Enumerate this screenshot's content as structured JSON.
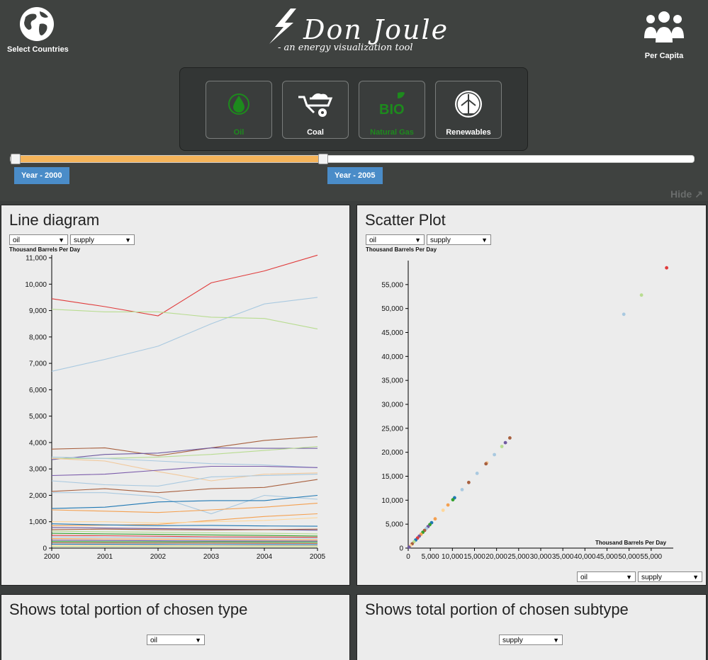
{
  "header": {
    "select_countries_label": "Select Countries",
    "logo_title": "Don Joule",
    "logo_subtitle": "- an energy visualization tool",
    "per_capita_label": "Per Capita",
    "hide_label": "Hide",
    "types": [
      {
        "label": "Oil",
        "icon": "oil-drop-icon",
        "color": "#1d8a1d"
      },
      {
        "label": "Coal",
        "icon": "wheelbarrow-icon",
        "color": "#ffffff"
      },
      {
        "label": "Natural Gas",
        "icon": "bio-icon",
        "color": "#1d8a1d"
      },
      {
        "label": "Renewables",
        "icon": "wind-turbine-icon",
        "color": "#ffffff"
      }
    ],
    "slider": {
      "min_year": 2000,
      "max_year": 2005,
      "start_label": "Year - 2000",
      "end_label": "Year - 2005",
      "fill_color": "#f5b45a"
    }
  },
  "line_panel": {
    "title": "Line diagram",
    "type_select": "oil",
    "subtype_select": "supply",
    "unit_label": "Thousand Barrels Per Day"
  },
  "scatter_panel": {
    "title": "Scatter Plot",
    "type_select": "oil",
    "subtype_select": "supply",
    "unit_label": "Thousand Barrels Per Day",
    "x_unit_label": "Thousand Barrels Per Day",
    "bottom_type_select": "oil",
    "bottom_subtype_select": "supply"
  },
  "type_portion_panel": {
    "title": "Shows total portion of chosen type",
    "select": "oil"
  },
  "subtype_portion_panel": {
    "title": "Shows total portion of chosen subtype",
    "select": "supply"
  },
  "chart_data": [
    {
      "type": "line",
      "x": [
        2000,
        2001,
        2002,
        2003,
        2004,
        2005
      ],
      "ylabel": "Thousand Barrels Per Day",
      "ylim": [
        0,
        11000
      ],
      "yticks": [
        "0",
        "1,000",
        "2,000",
        "3,000",
        "4,000",
        "5,000",
        "6,000",
        "7,000",
        "8,000",
        "9,000",
        "10,000",
        "11,000"
      ],
      "xticks": [
        "2000",
        "2001",
        "2002",
        "2003",
        "2004",
        "2005"
      ],
      "series": [
        {
          "color": "#e03b3b",
          "values": [
            9450,
            9150,
            8800,
            10050,
            10500,
            11100
          ]
        },
        {
          "color": "#a9c9e0",
          "values": [
            6700,
            7150,
            7650,
            8500,
            9250,
            9500
          ]
        },
        {
          "color": "#b8dc90",
          "values": [
            9050,
            8950,
            8950,
            8750,
            8700,
            8300
          ]
        },
        {
          "color": "#a8603f",
          "values": [
            3750,
            3800,
            3500,
            3800,
            4080,
            4220
          ]
        },
        {
          "color": "#6f5aa0",
          "values": [
            3350,
            3550,
            3600,
            3800,
            3780,
            3780
          ]
        },
        {
          "color": "#b8dc90",
          "values": [
            3400,
            3400,
            3450,
            3550,
            3700,
            3850
          ]
        },
        {
          "color": "#a9c9e0",
          "values": [
            3450,
            3400,
            3300,
            3200,
            3150,
            3050
          ]
        },
        {
          "color": "#f2c89a",
          "values": [
            3400,
            3300,
            2900,
            2550,
            2800,
            2850
          ]
        },
        {
          "color": "#7a5aaa",
          "values": [
            2750,
            2800,
            2950,
            3100,
            3100,
            3050
          ]
        },
        {
          "color": "#a9c9e0",
          "values": [
            2550,
            2400,
            2350,
            2700,
            2750,
            2800
          ]
        },
        {
          "color": "#a8603f",
          "values": [
            2150,
            2250,
            2100,
            2250,
            2300,
            2600
          ]
        },
        {
          "color": "#a9c9e0",
          "values": [
            2100,
            2100,
            1950,
            1300,
            2000,
            1850
          ]
        },
        {
          "color": "#1f78b4",
          "values": [
            1500,
            1550,
            1750,
            1800,
            1800,
            2000
          ]
        },
        {
          "color": "#f4a050",
          "values": [
            1450,
            1400,
            1350,
            1450,
            1550,
            1700
          ]
        },
        {
          "color": "#f4a050",
          "values": [
            850,
            870,
            900,
            1050,
            1200,
            1300
          ]
        },
        {
          "color": "#ffd79a",
          "values": [
            1000,
            1000,
            950,
            1000,
            1050,
            1150
          ]
        },
        {
          "color": "#1f78b4",
          "values": [
            920,
            880,
            850,
            860,
            840,
            830
          ]
        },
        {
          "color": "#6f5aa0",
          "values": [
            780,
            760,
            740,
            720,
            700,
            680
          ]
        },
        {
          "color": "#a8603f",
          "values": [
            700,
            720,
            700,
            690,
            700,
            720
          ]
        },
        {
          "color": "#b8dc90",
          "values": [
            640,
            620,
            600,
            580,
            560,
            540
          ]
        },
        {
          "color": "#33a02c",
          "values": [
            560,
            540,
            520,
            500,
            480,
            460
          ]
        },
        {
          "color": "#e03b3b",
          "values": [
            480,
            470,
            450,
            430,
            420,
            410
          ]
        },
        {
          "color": "#a9c9e0",
          "values": [
            420,
            410,
            400,
            390,
            380,
            370
          ]
        },
        {
          "color": "#f4a050",
          "values": [
            360,
            350,
            340,
            330,
            320,
            310
          ]
        },
        {
          "color": "#6f5aa0",
          "values": [
            300,
            290,
            280,
            275,
            270,
            265
          ]
        },
        {
          "color": "#33a02c",
          "values": [
            250,
            245,
            240,
            235,
            230,
            225
          ]
        },
        {
          "color": "#a8603f",
          "values": [
            200,
            195,
            190,
            185,
            180,
            175
          ]
        },
        {
          "color": "#1f78b4",
          "values": [
            150,
            145,
            140,
            135,
            130,
            125
          ]
        },
        {
          "color": "#ffd79a",
          "values": [
            100,
            98,
            96,
            94,
            92,
            90
          ]
        },
        {
          "color": "#b8dc90",
          "values": [
            60,
            58,
            56,
            54,
            52,
            50
          ]
        }
      ]
    },
    {
      "type": "scatter",
      "xlabel": "Thousand Barrels Per Day",
      "ylabel": "Thousand Barrels Per Day",
      "xlim": [
        0,
        60000
      ],
      "ylim": [
        0,
        60000
      ],
      "xticks": [
        "0",
        "5,000",
        "10,000",
        "15,000",
        "20,000",
        "25,000",
        "30,000",
        "35,000",
        "40,000",
        "45,000",
        "50,000",
        "55,000"
      ],
      "yticks": [
        "0",
        "5,000",
        "10,000",
        "15,000",
        "20,000",
        "25,000",
        "30,000",
        "35,000",
        "40,000",
        "45,000",
        "50,000",
        "55,000"
      ],
      "points": [
        {
          "x": 58500,
          "y": 58500,
          "color": "#e03b3b"
        },
        {
          "x": 52800,
          "y": 52800,
          "color": "#b8dc90"
        },
        {
          "x": 48800,
          "y": 48800,
          "color": "#a9c9e0"
        },
        {
          "x": 23000,
          "y": 23000,
          "color": "#a8603f"
        },
        {
          "x": 22000,
          "y": 22000,
          "color": "#6f5aa0"
        },
        {
          "x": 21200,
          "y": 21200,
          "color": "#b8dc90"
        },
        {
          "x": 19500,
          "y": 19500,
          "color": "#a9c9e0"
        },
        {
          "x": 17800,
          "y": 17800,
          "color": "#f2c89a"
        },
        {
          "x": 17600,
          "y": 17600,
          "color": "#a8603f"
        },
        {
          "x": 15600,
          "y": 15600,
          "color": "#a9c9e0"
        },
        {
          "x": 13700,
          "y": 13700,
          "color": "#a8603f"
        },
        {
          "x": 12200,
          "y": 12200,
          "color": "#a9c9e0"
        },
        {
          "x": 10500,
          "y": 10500,
          "color": "#1f78b4"
        },
        {
          "x": 10100,
          "y": 10100,
          "color": "#33a02c"
        },
        {
          "x": 9000,
          "y": 9000,
          "color": "#f4a050"
        },
        {
          "x": 7900,
          "y": 7900,
          "color": "#ffd79a"
        },
        {
          "x": 6100,
          "y": 6100,
          "color": "#f4a050"
        },
        {
          "x": 5300,
          "y": 5300,
          "color": "#1f78b4"
        },
        {
          "x": 4900,
          "y": 4900,
          "color": "#33a02c"
        },
        {
          "x": 4500,
          "y": 4500,
          "color": "#6f5aa0"
        },
        {
          "x": 4100,
          "y": 4100,
          "color": "#a9c9e0"
        },
        {
          "x": 3700,
          "y": 3700,
          "color": "#a8603f"
        },
        {
          "x": 3300,
          "y": 3300,
          "color": "#33a02c"
        },
        {
          "x": 2900,
          "y": 2900,
          "color": "#f4a050"
        },
        {
          "x": 2500,
          "y": 2500,
          "color": "#6f5aa0"
        },
        {
          "x": 2100,
          "y": 2100,
          "color": "#e03b3b"
        },
        {
          "x": 1700,
          "y": 1700,
          "color": "#1f78b4"
        },
        {
          "x": 1300,
          "y": 1300,
          "color": "#b8dc90"
        },
        {
          "x": 900,
          "y": 900,
          "color": "#a8603f"
        },
        {
          "x": 500,
          "y": 500,
          "color": "#ffd79a"
        },
        {
          "x": 200,
          "y": 200,
          "color": "#6f5aa0"
        }
      ]
    }
  ]
}
